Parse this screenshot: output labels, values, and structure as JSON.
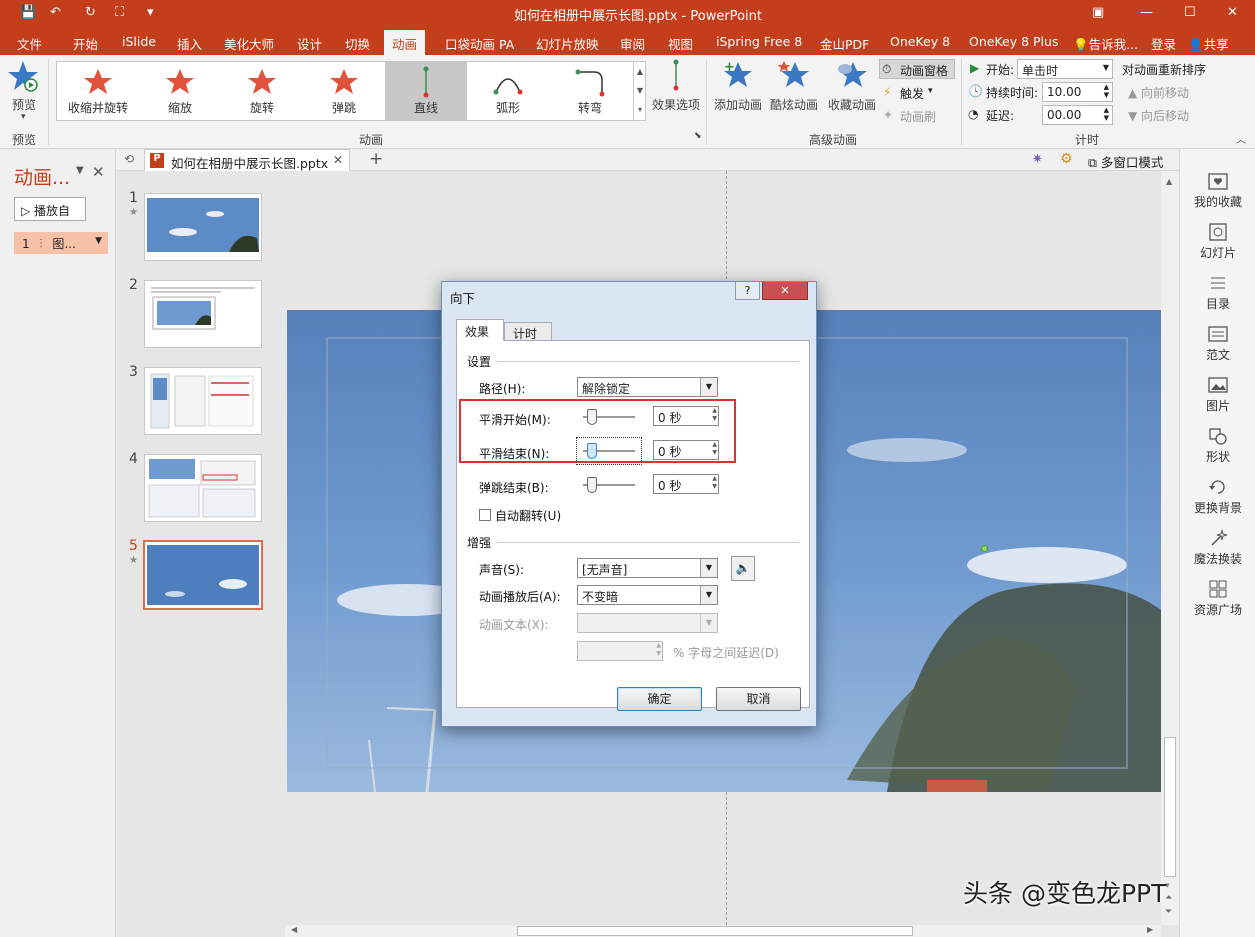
{
  "window": {
    "title": "如何在相册中展示长图.pptx - PowerPoint"
  },
  "tabs": [
    "文件",
    "开始",
    "iSlide",
    "插入",
    "美化大师",
    "设计",
    "切换",
    "动画",
    "口袋动画 PA",
    "幻灯片放映",
    "审阅",
    "视图",
    "iSpring Free 8",
    "金山PDF",
    "OneKey 8",
    "OneKey 8 Plus"
  ],
  "tabs_right": {
    "tell": "告诉我...",
    "login": "登录",
    "share": "共享"
  },
  "ribbon": {
    "preview": "预览",
    "preview_group": "预览",
    "animations": [
      "收缩并旋转",
      "缩放",
      "旋转",
      "弹跳",
      "直线",
      "弧形",
      "转弯"
    ],
    "animation_group": "动画",
    "effect_options": "效果选项",
    "add_anim": "添加动画",
    "cool_anim": "酷炫动画",
    "fav_anim": "收藏动画",
    "anim_pane": "动画窗格",
    "trigger": "触发",
    "anim_brush": "动画刷",
    "advanced_group": "高级动画",
    "start_label": "开始:",
    "start_value": "单击时",
    "duration_label": "持续时间:",
    "duration_value": "10.00",
    "delay_label": "延迟:",
    "delay_value": "00.00",
    "timing_group": "计时",
    "reorder": "对动画重新排序",
    "move_earlier": "向前移动",
    "move_later": "向后移动"
  },
  "anim_pane": {
    "title": "动画...",
    "play": "播放自",
    "item_num": "1",
    "item_label": "图..."
  },
  "doc_tab": {
    "name": "如何在相册中展示长图.pptx",
    "multiwindow": "多窗口模式"
  },
  "slides": [
    "1",
    "2",
    "3",
    "4",
    "5"
  ],
  "right_pane": [
    "我的收藏",
    "幻灯片",
    "目录",
    "范文",
    "图片",
    "形状",
    "更换背景",
    "魔法换装",
    "资源广场"
  ],
  "dialog": {
    "title": "向下",
    "tabs": [
      "效果",
      "计时"
    ],
    "settings": "设置",
    "path_label": "路径(H):",
    "path_value": "解除锁定",
    "smooth_start_label": "平滑开始(M):",
    "smooth_start_value": "0 秒",
    "smooth_end_label": "平滑结束(N):",
    "smooth_end_value": "0 秒",
    "bounce_end_label": "弹跳结束(B):",
    "bounce_end_value": "0 秒",
    "auto_reverse": "自动翻转(U)",
    "enhance": "增强",
    "sound_label": "声音(S):",
    "sound_value": "[无声音]",
    "after_label": "动画播放后(A):",
    "after_value": "不变暗",
    "text_label": "动画文本(X):",
    "delay_suffix": "% 字母之间延迟(D)",
    "ok": "确定",
    "cancel": "取消"
  },
  "watermark": "头条 @变色龙PPT",
  "colors": {
    "accent": "#c43e1c",
    "highlight": "#e03030"
  }
}
